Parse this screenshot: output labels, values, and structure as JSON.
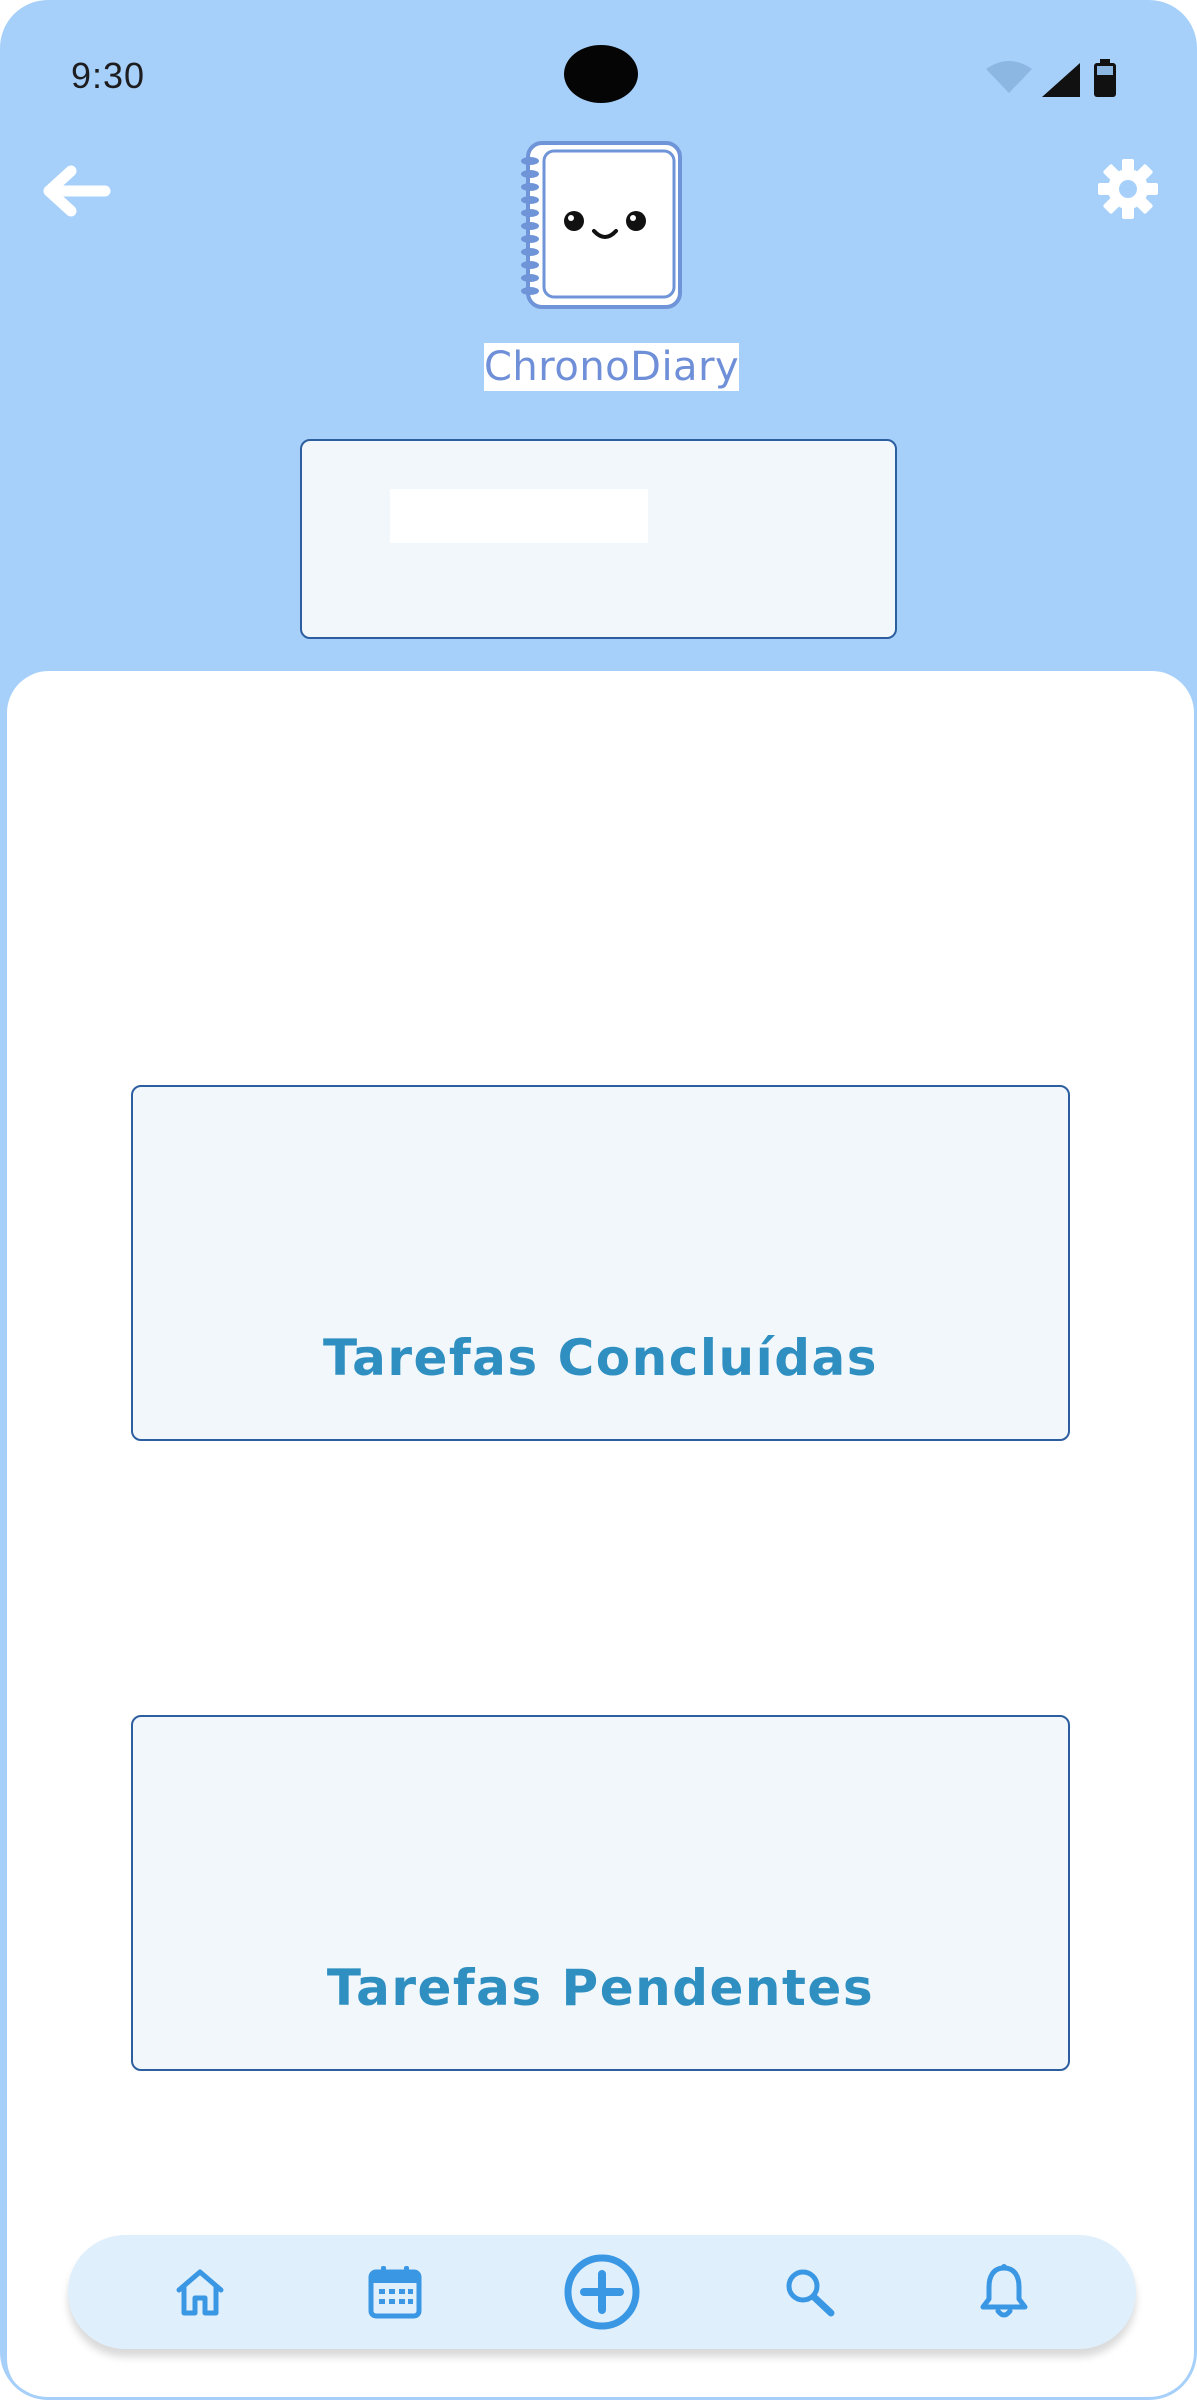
{
  "status_bar": {
    "time": "9:30"
  },
  "app": {
    "name": "ChronoDiary"
  },
  "header": {
    "back_icon": "arrow-left-icon",
    "settings_icon": "gear-icon"
  },
  "cards": {
    "completed_label": "Tarefas Concluídas",
    "pending_label": "Tarefas Pendentes"
  },
  "bottom_nav": {
    "items": [
      {
        "icon": "home-icon"
      },
      {
        "icon": "calendar-icon"
      },
      {
        "icon": "add-circle-icon"
      },
      {
        "icon": "search-icon"
      },
      {
        "icon": "bell-icon"
      }
    ]
  },
  "colors": {
    "header_background": "#a6d0fa",
    "card_border": "#2d5fa0",
    "card_fill": "#f2f7fc",
    "card_text": "#2f8fc0",
    "nav_icon": "#3a97e4",
    "nav_background": "#e0effc"
  }
}
